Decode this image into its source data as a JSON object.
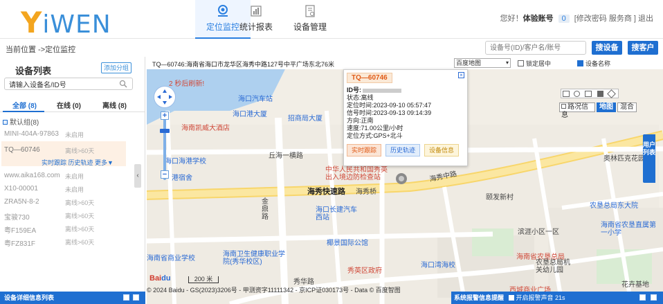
{
  "brand": {
    "y": "Y",
    "rest": "iWEN"
  },
  "nav": [
    {
      "label": "定位监控",
      "icon": "location-icon",
      "active": true
    },
    {
      "label": "统计报表",
      "icon": "bar-chart-icon",
      "active": false
    },
    {
      "label": "设备管理",
      "icon": "device-manage-icon",
      "active": false
    }
  ],
  "header_right": {
    "greeting": "您好！",
    "account": "体验账号",
    "count": "0",
    "links": "[修改密码 服务商 ] 退出"
  },
  "breadcrumb": "当前位置 ->定位监控",
  "search": {
    "placeholder": "设备号(ID)/客户名/账号",
    "search_device": "搜设备",
    "search_client": "搜客户"
  },
  "sidebar": {
    "title": "设备列表",
    "add_group": "添加分组",
    "search_value": "请输入设备名/ID号",
    "tabs": [
      "全部 (8)",
      "在线 (0)",
      "离线 (8)"
    ],
    "group": "默认组(8)",
    "devices": [
      {
        "name": "MINI-404A-97863",
        "status": "未启用"
      },
      {
        "name": "TQ—60746",
        "status": "离线>60天"
      },
      {
        "name": "www.aika168.com",
        "status": "未启用"
      },
      {
        "name": "X10-00001",
        "status": "未启用"
      },
      {
        "name": "ZRA5N-8-2",
        "status": "离线>60天"
      },
      {
        "name": "宝骏730",
        "status": "离线>60天"
      },
      {
        "name": "粤F159EA",
        "status": "离线>60天"
      },
      {
        "name": "粤FZ831F",
        "status": "离线>60天"
      }
    ],
    "selected_actions": "实时跟踪 历史轨迹 更多▼",
    "footer": "设备详细信息列表"
  },
  "map": {
    "address": "TQ—60746:海南省海口市龙华区海秀中路127号中平广场东北76米",
    "map_type": "百度地图",
    "lock_center": "锁定居中",
    "device_name": "设备名称",
    "refresh_note": "2 秒后刷新!",
    "traffic": "路况信息",
    "layer_map": "地图",
    "layer_hybrid": "混合",
    "labels": [
      "海口汽车站",
      "海口港大厦",
      "招商局大厦",
      "海南凯威大酒店",
      "丘海一横路",
      "海口海港学校",
      "港宿舍",
      "中华人民共和国秀英",
      "出入境边防检查站",
      "海秀桥",
      "海秀中路",
      "海秀快速路",
      "金鼎路",
      "海口长建汽车西站",
      "椰景国际公馆",
      "海南卫生健康职业学院(秀华校区)",
      "海南省商业学校",
      "秀英区政府",
      "海口湾海校",
      "秀华路",
      "颐发新村",
      "农垦总局东大院",
      "海南省农垦直属第一小学",
      "滨涯小区一区",
      "海南省农垦总局",
      "农垦总局机关幼儿园",
      "奥林匹克花园",
      "花卉基地",
      "西城商业广场"
    ],
    "scale": "200 米",
    "copyright": "© 2024 Baidu - GS(2023)3206号 - 甲测资字11111342 - 京ICP证030173号 - Data © 百度智图",
    "user_list": "用户列表"
  },
  "popup": {
    "title": "TQ—60746",
    "id_label": "ID号:",
    "status": "状态:离线",
    "locate_time": "定位时间:2023-09-10 05:57:47",
    "signal_time": "信号时间:2023-09-13 09:14:39",
    "direction": "方向:正南",
    "speed": "速度:71.00公里/小时",
    "locate_mode": "定位方式:GPS+北斗",
    "btn_track": "实时跟踪",
    "btn_history": "历史轨迹",
    "btn_info": "设备信息"
  },
  "alarm": {
    "label": "系统报警信息提醒",
    "sound": "开启报警声音 21s"
  },
  "colors": {
    "primary": "#1f6fd1",
    "accent": "#f3a51f",
    "warning": "#e05b18"
  }
}
